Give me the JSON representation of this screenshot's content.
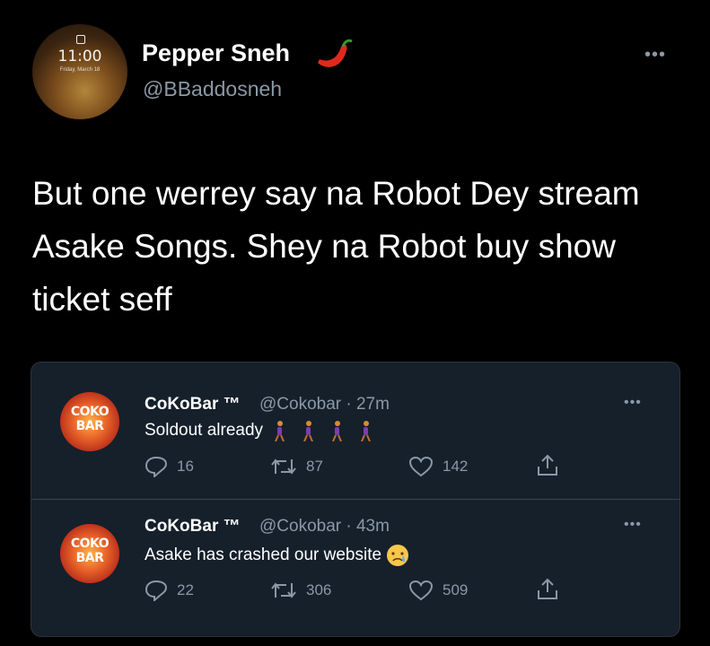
{
  "author": {
    "name": "Pepper Sneh",
    "handle": "@BBaddosneh",
    "avatar_clock": "11:00",
    "avatar_date": "Friday, March 18"
  },
  "tweet": {
    "text": "But one werrey say na Robot Dey stream Asake Songs. Shey na Robot buy show ticket seff"
  },
  "quotes": [
    {
      "name": "CoKoBar ™",
      "handle": "@Cokobar · 27m",
      "text": "Soldout already",
      "emoji": "walking-person-x4",
      "replies": "16",
      "retweets": "87",
      "likes": "142"
    },
    {
      "name": "CoKoBar ™",
      "handle": "@Cokobar · 43m",
      "text": "Asake has crashed our website",
      "emoji": "crying-face",
      "replies": "22",
      "retweets": "306",
      "likes": "509"
    }
  ],
  "icons": {
    "more": "more-icon",
    "reply": "reply-icon",
    "retweet": "retweet-icon",
    "like": "like-icon",
    "share": "share-icon"
  },
  "colors": {
    "background": "#000000",
    "card": "#15202b",
    "muted": "#8b98a5",
    "text": "#ffffff"
  }
}
